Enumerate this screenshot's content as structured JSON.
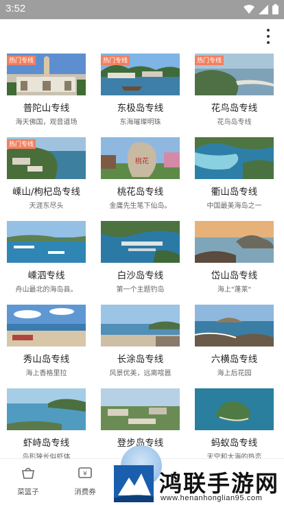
{
  "status": {
    "time": "3:52"
  },
  "cards": [
    {
      "title": "普陀山专线",
      "subtitle": "海天佛国，观音道场",
      "badge": "热门专线"
    },
    {
      "title": "东极岛专线",
      "subtitle": "东海璀璨明珠",
      "badge": "热门专线"
    },
    {
      "title": "花鸟岛专线",
      "subtitle": "花鸟岛专线",
      "badge": "热门专线"
    },
    {
      "title": "嵊山/枸杞岛专线",
      "subtitle": "天涯东尽头",
      "badge": "热门专线"
    },
    {
      "title": "桃花岛专线",
      "subtitle": "金庸先生笔下仙岛。",
      "badge": ""
    },
    {
      "title": "衢山岛专线",
      "subtitle": "中国最美海岛之一",
      "badge": ""
    },
    {
      "title": "嵊泗专线",
      "subtitle": "舟山最北的海岛县。",
      "badge": ""
    },
    {
      "title": "白沙岛专线",
      "subtitle": "第一个主题钓岛",
      "badge": ""
    },
    {
      "title": "岱山岛专线",
      "subtitle": "海上\"蓬莱\"",
      "badge": ""
    },
    {
      "title": "秀山岛专线",
      "subtitle": "海上香格里拉",
      "badge": ""
    },
    {
      "title": "长涂岛专线",
      "subtitle": "风景优美，远离喧嚣",
      "badge": ""
    },
    {
      "title": "六横岛专线",
      "subtitle": "海上后花园",
      "badge": ""
    },
    {
      "title": "虾峙岛专线",
      "subtitle": "岛形狭长似虾体",
      "badge": ""
    },
    {
      "title": "登步岛专线",
      "subtitle": "",
      "badge": ""
    },
    {
      "title": "蚂蚁岛专线",
      "subtitle": "天空和大海的热恋",
      "badge": ""
    }
  ],
  "tabs": [
    {
      "label": "菜篮子",
      "icon": "basket-icon"
    },
    {
      "label": "消费券",
      "icon": "coupon-icon"
    }
  ],
  "watermark": {
    "brand": "鸿联手游网",
    "url": "www.henanhonglian95.com"
  },
  "colors": {
    "badge": "#f08060",
    "statusbar": "#9e9e9e"
  }
}
